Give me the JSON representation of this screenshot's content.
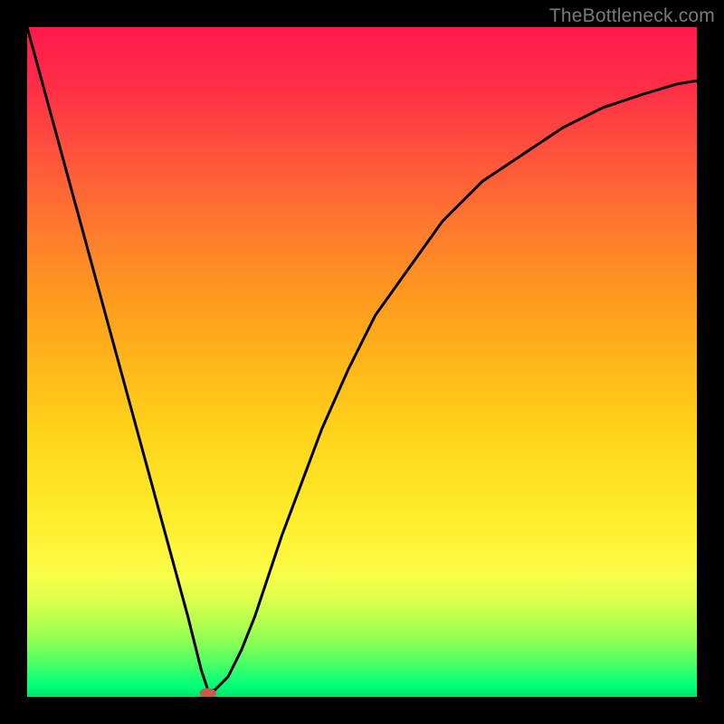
{
  "watermark": "TheBottleneck.com",
  "chart_data": {
    "type": "line",
    "title": "",
    "xlabel": "",
    "ylabel": "",
    "xlim": [
      0,
      100
    ],
    "ylim": [
      0,
      100
    ],
    "grid": false,
    "annotations": {
      "marker": {
        "x": 27,
        "y": 0.5,
        "color": "#c65a50"
      }
    },
    "series": [
      {
        "name": "curve",
        "color": "#000000",
        "x": [
          0,
          3,
          6,
          9,
          12,
          15,
          18,
          21,
          24,
          26,
          27,
          28,
          30,
          32,
          34,
          36,
          38,
          41,
          44,
          48,
          52,
          57,
          62,
          68,
          74,
          80,
          86,
          92,
          97,
          100
        ],
        "y": [
          100,
          89,
          78,
          67,
          56,
          45,
          34,
          23,
          12,
          4,
          1,
          1,
          3,
          7,
          12,
          18,
          24,
          32,
          40,
          49,
          57,
          64,
          71,
          77,
          81,
          85,
          88,
          90,
          91.5,
          92
        ]
      }
    ]
  }
}
